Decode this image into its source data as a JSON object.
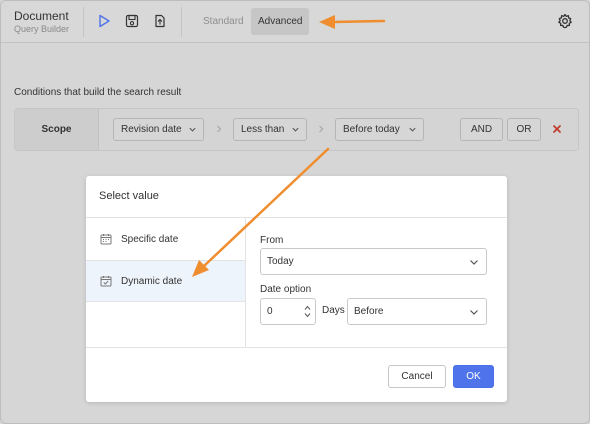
{
  "header": {
    "title": "Document",
    "subtitle": "Query Builder",
    "tools": [
      {
        "name": "run",
        "icon": "play-icon"
      },
      {
        "name": "save",
        "icon": "save-icon"
      },
      {
        "name": "export",
        "icon": "export-icon"
      }
    ],
    "tabs": [
      {
        "label": "Standard",
        "active": false
      },
      {
        "label": "Advanced",
        "active": true
      }
    ],
    "settings_icon": "gear-icon"
  },
  "conditions": {
    "heading": "Conditions that build the search result",
    "scope_label": "Scope",
    "field": "Revision date",
    "operator": "Less than",
    "value": "Before today",
    "and_label": "AND",
    "or_label": "OR",
    "delete_icon": "close-icon"
  },
  "dialog": {
    "title": "Select value",
    "options": [
      {
        "label": "Specific date",
        "icon": "calendar-icon",
        "selected": false
      },
      {
        "label": "Dynamic date",
        "icon": "calendar-check-icon",
        "selected": true
      }
    ],
    "from_label": "From",
    "from_value": "Today",
    "date_option_label": "Date option",
    "number_value": "0",
    "days_label": "Days",
    "direction_value": "Before",
    "cancel_label": "Cancel",
    "ok_label": "OK"
  },
  "colors": {
    "accent": "#4f73ea",
    "annotation": "#ef8d2f",
    "delete": "#c0392b"
  }
}
